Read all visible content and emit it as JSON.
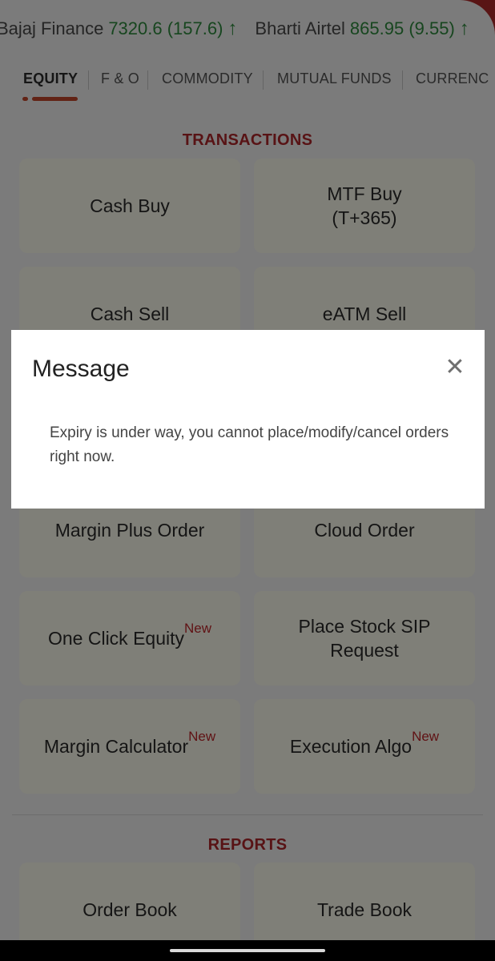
{
  "ticker": [
    {
      "name": "Bajaj Finance",
      "value": "7320.6 (157.6)",
      "arrow": "↑"
    },
    {
      "name": "Bharti Airtel",
      "value": "865.95 (9.55)",
      "arrow": "↑"
    }
  ],
  "tabs": [
    "EQUITY",
    "F & O",
    "COMMODITY",
    "MUTUAL FUNDS",
    "CURRENC"
  ],
  "active_tab": "EQUITY",
  "transactions": {
    "title": "TRANSACTIONS",
    "tiles": [
      {
        "label": "Cash Buy"
      },
      {
        "label": "MTF Buy\n(T+365)"
      },
      {
        "label": "Cash Sell"
      },
      {
        "label": "eATM Sell"
      },
      {
        "label": "Margin Plus Order"
      },
      {
        "label": "Cloud Order"
      },
      {
        "label": "One Click Equity",
        "badge": "New"
      },
      {
        "label": "Place Stock SIP\nRequest"
      },
      {
        "label": "Margin Calculator",
        "badge": "New"
      },
      {
        "label": "Execution Algo",
        "badge": "New"
      }
    ]
  },
  "reports": {
    "title": "REPORTS",
    "tiles": [
      {
        "label": "Order Book"
      },
      {
        "label": "Trade Book"
      }
    ]
  },
  "dialog": {
    "title": "Message",
    "close_icon": "close-icon",
    "body": "Expiry is under way, you cannot place/modify/cancel orders right now."
  },
  "colors": {
    "brand_red": "#b22a2a",
    "section_title": "#b0262a",
    "ticker_up": "#2f8c3e",
    "tile_bg": "#fffef0"
  }
}
